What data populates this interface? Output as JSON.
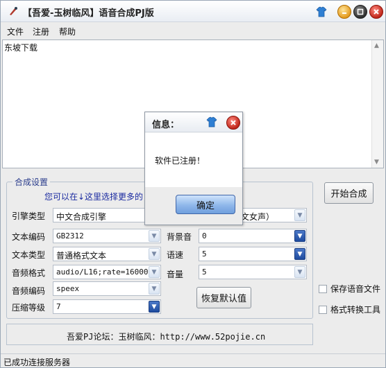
{
  "window": {
    "title": "【吾爱-玉树临风】语音合成PJ版"
  },
  "menu": [
    "文件",
    "注册",
    "帮助"
  ],
  "textarea": {
    "content": "东坡下载"
  },
  "group": {
    "title": "合成设置",
    "hint": "您可以在↓这里选择更多的"
  },
  "fields": {
    "engine_type": {
      "label": "引擎类型",
      "value": "中文合成引擎"
    },
    "voice_partial": {
      "value": "文女声）"
    },
    "text_encoding": {
      "label": "文本编码",
      "value": "GB2312"
    },
    "text_type": {
      "label": "文本类型",
      "value": "普通格式文本"
    },
    "audio_format": {
      "label": "音频格式",
      "value": "audio/L16;rate=16000"
    },
    "audio_encoding": {
      "label": "音频编码",
      "value": "speex"
    },
    "compression": {
      "label": "压缩等级",
      "value": "7"
    },
    "bg_sound": {
      "label": "背景音",
      "value": "0"
    },
    "speed": {
      "label": "语速",
      "value": "5"
    },
    "volume": {
      "label": "音量",
      "value": "5"
    }
  },
  "buttons": {
    "start": "开始合成",
    "reset": "恢复默认值"
  },
  "checkboxes": {
    "save_audio": "保存语音文件",
    "convert_tool": "格式转换工具"
  },
  "footer": {
    "text": "吾爱PJ论坛：玉树临风：http://www.52pojie.cn"
  },
  "status": {
    "text": "已成功连接服务器"
  },
  "dialog": {
    "title": "信息：",
    "message": "软件已注册！",
    "ok": "确定"
  }
}
